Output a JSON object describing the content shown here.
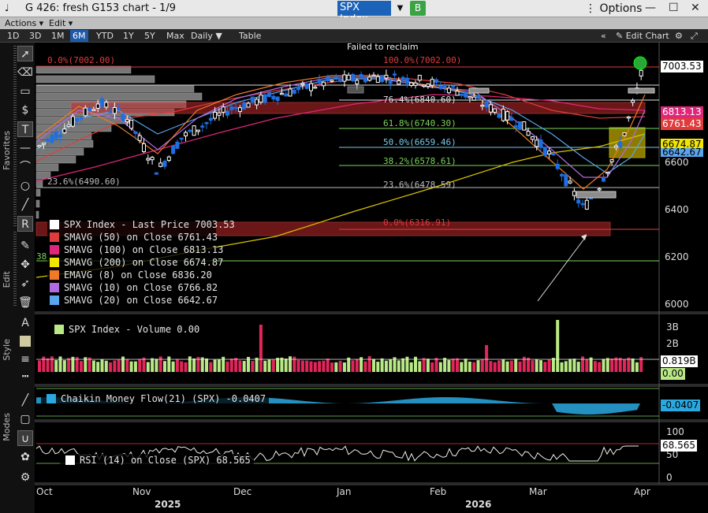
{
  "window": {
    "icon": "♩",
    "title": "G 426: fresh G153 chart - 1/9",
    "ticker": "SPX Index",
    "ticker_dropdown": "▼",
    "button_b": "B",
    "options": "Options",
    "options_icon": "⋮",
    "controls": [
      "—",
      "☐",
      "✕"
    ]
  },
  "menu": {
    "actions": "Actions ▾",
    "edit": "Edit ▾"
  },
  "toolbar": {
    "ranges": [
      "1D",
      "3D",
      "1M",
      "6M",
      "YTD",
      "1Y",
      "5Y",
      "Max"
    ],
    "active_range": "6M",
    "frequency": "Daily ▼",
    "table": "Table",
    "collapse": "«",
    "edit_chart": "Edit Chart",
    "edit_icon": "✎",
    "settings_icon": "⚙",
    "zoom_icon": "⤢"
  },
  "palette": {
    "labels": {
      "favorites": "Favorites",
      "edit": "Edit",
      "style": "Style",
      "modes": "Modes"
    },
    "tools": [
      "pointer",
      "eraser",
      "rectangle",
      "dollar-label",
      "text",
      "horizontal-line",
      "arc",
      "circle",
      "trend-line",
      "R-tool",
      "pen",
      "move-cross",
      "select-arrow",
      "trash",
      "text-A",
      "color-swatch",
      "line-weight",
      "more",
      "dash-line",
      "annotate",
      "style-color",
      "magnet",
      "circle-palette",
      "gear"
    ]
  },
  "annotations": {
    "failed_to_reclaim": "Failed to reclaim"
  },
  "fib_levels": {
    "left": [
      {
        "label": "0.0%(7002.00)",
        "color": "#e03c3c"
      },
      {
        "label": "23.6%(6490.60)",
        "color": "#bdbdbd"
      },
      {
        "label": "38",
        "color": "#7bd45b"
      }
    ],
    "right": [
      {
        "label": "100.0%(7002.00)",
        "color": "#e03c3c"
      },
      {
        "label": "76.4%(6840.60)",
        "color": "#e5e5e5"
      },
      {
        "label": "61.8%(6740.30)",
        "color": "#7bd45b"
      },
      {
        "label": "50.0%(6659.46)",
        "color": "#7bc8e8"
      },
      {
        "label": "38.2%(6578.61)",
        "color": "#7bd45b"
      },
      {
        "label": "23.6%(6478.59)",
        "color": "#bdbdbd"
      },
      {
        "label": "0.0%(6316.91)",
        "color": "#e03c3c"
      }
    ]
  },
  "price_axis": {
    "ticks": [
      "6000",
      "6200",
      "6400",
      "6600"
    ],
    "tags": [
      {
        "text": "7003.53",
        "bg": "#ffffff",
        "fg": "#000000"
      },
      {
        "text": "6813.13",
        "bg": "#e0267a",
        "fg": "#ffffff"
      },
      {
        "text": "6761.43",
        "bg": "#e03c3c",
        "fg": "#ffffff"
      },
      {
        "text": "6674.87",
        "bg": "#f2e600",
        "fg": "#000000"
      },
      {
        "text": "6642.67",
        "bg": "#5aa6ee",
        "fg": "#000000"
      }
    ]
  },
  "main_legend": [
    {
      "text": "SPX Index - Last Price 7003.53",
      "color": "#ffffff"
    },
    {
      "text": "SMAVG (50)  on Close 6761.43",
      "color": "#e03c3c"
    },
    {
      "text": "SMAVG (100)  on Close 6813.13",
      "color": "#e0267a"
    },
    {
      "text": "SMAVG (200)  on Close 6674.87",
      "color": "#f2e600"
    },
    {
      "text": "EMAVG (8)  on Close   6836.20",
      "color": "#f07a28"
    },
    {
      "text": "SMAVG (10)  on Close 6766.82",
      "color": "#b06be0"
    },
    {
      "text": "SMAVG (20)  on Close 6642.67",
      "color": "#5aa6ee"
    }
  ],
  "volume_panel": {
    "legend": "SPX Index - Volume 0.00",
    "legend_color": "#b8e986",
    "ticks": [
      "3B",
      "2B"
    ],
    "tags": [
      {
        "text": "0.819B",
        "bg": "#ffffff",
        "fg": "#000000"
      },
      {
        "text": "0.00",
        "bg": "#b8e986",
        "fg": "#000000"
      }
    ]
  },
  "cmf_panel": {
    "legend": "Chaikin Money Flow(21) (SPX) -0.0407",
    "legend_color": "#29a9e0",
    "tag": {
      "text": "-0.0407",
      "bg": "#29a9e0",
      "fg": "#000000"
    }
  },
  "rsi_panel": {
    "legend": "RSI (14)  on Close (SPX) 68.565",
    "legend_color": "#ffffff",
    "ticks": [
      "100",
      "50",
      "0"
    ],
    "tag": {
      "text": "68.565",
      "bg": "#ffffff",
      "fg": "#000000"
    }
  },
  "time_axis": {
    "months": [
      "Oct",
      "Nov",
      "Dec",
      "Jan",
      "Feb",
      "Mar",
      "Apr"
    ],
    "years": [
      "2025",
      "2026"
    ]
  },
  "colors": {
    "up_candle": "#ffffff",
    "down_candle": "#1f6fe0",
    "sma50": "#e03c3c",
    "sma100": "#e0267a",
    "sma200": "#d9c400",
    "ema8": "#f07a28",
    "sma10": "#b06be0",
    "sma20": "#5aa6ee",
    "vol_up": "#b8e986",
    "vol_down": "#e0265a",
    "cmf": "#29a9e0"
  }
}
